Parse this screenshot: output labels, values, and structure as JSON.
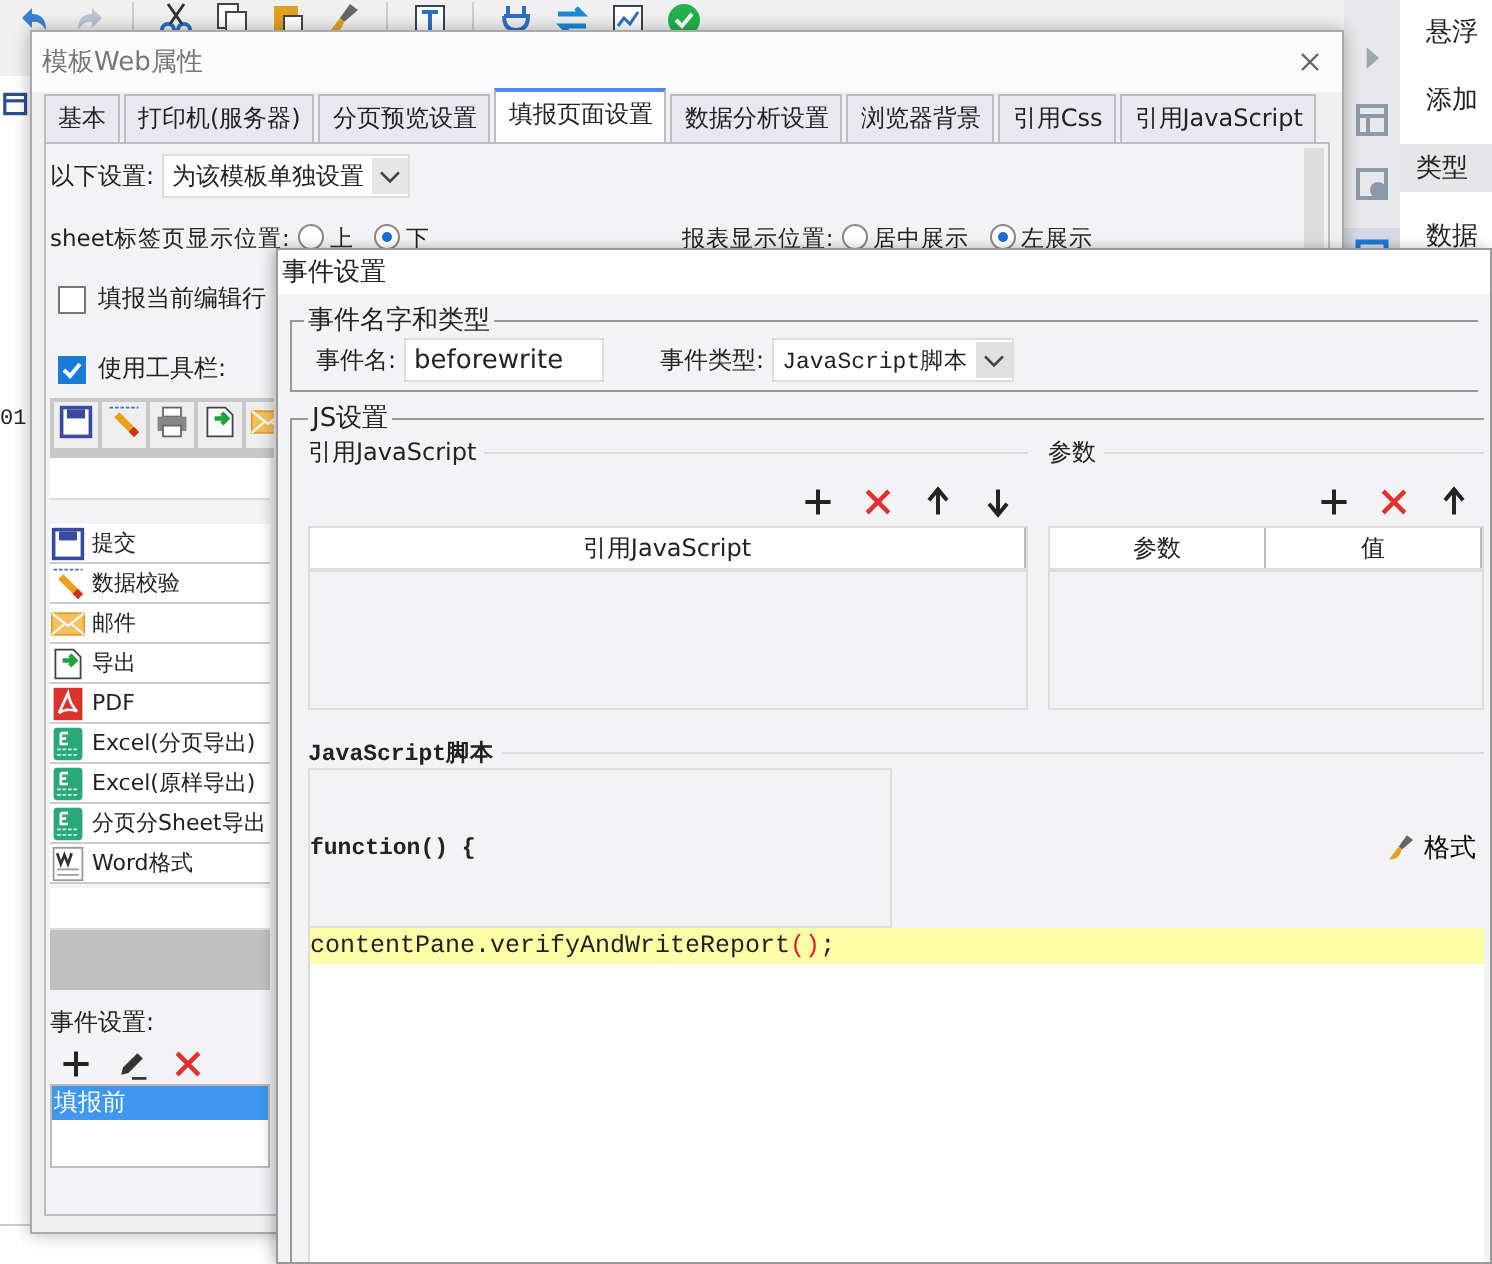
{
  "app": {
    "cell_text": "01",
    "side_panel": [
      {
        "label": "悬浮",
        "kind": "plain"
      },
      {
        "label": "添加",
        "kind": "plain"
      },
      {
        "label": "类型",
        "kind": "header"
      },
      {
        "label": "数据",
        "kind": "plain"
      }
    ]
  },
  "web_properties": {
    "title": "模板Web属性",
    "tabs": [
      {
        "label": "基本",
        "selected": false
      },
      {
        "label": "打印机(服务器)",
        "selected": false
      },
      {
        "label": "分页预览设置",
        "selected": false
      },
      {
        "label": "填报页面设置",
        "selected": true
      },
      {
        "label": "数据分析设置",
        "selected": false
      },
      {
        "label": "浏览器背景",
        "selected": false
      },
      {
        "label": "引用Css",
        "selected": false
      },
      {
        "label": "引用JavaScript",
        "selected": false
      }
    ],
    "settings": {
      "label": "以下设置:",
      "value": "为该模板单独设置"
    },
    "sheet_position": {
      "label": "sheet标签页显示位置:",
      "options": [
        {
          "label": "上",
          "selected": false
        },
        {
          "label": "下",
          "selected": true
        }
      ]
    },
    "report_position": {
      "label": "报表显示位置:",
      "options": [
        {
          "label": "居中展示",
          "selected": false
        },
        {
          "label": "左展示",
          "selected": true
        }
      ]
    },
    "highlight_row": {
      "label": "填报当前编辑行",
      "checked": false
    },
    "use_toolbar": {
      "label": "使用工具栏:",
      "checked": true
    },
    "buttons": [
      {
        "label": "提交",
        "kind": "save"
      },
      {
        "label": "数据校验",
        "kind": "verify"
      },
      {
        "label": "邮件",
        "kind": "mail"
      },
      {
        "label": "导出",
        "kind": "export"
      },
      {
        "label": "PDF",
        "kind": "pdf"
      },
      {
        "label": "Excel(分页导出)",
        "kind": "excel"
      },
      {
        "label": "Excel(原样导出)",
        "kind": "excel"
      },
      {
        "label": "分页分Sheet导出",
        "kind": "excel"
      },
      {
        "label": "Word格式",
        "kind": "word"
      }
    ],
    "event_label": "事件设置:",
    "events": [
      {
        "label": "填报前",
        "selected": true
      }
    ]
  },
  "event_dialog": {
    "title": "事件设置",
    "name_group": "事件名字和类型",
    "name_label": "事件名:",
    "name_value": "beforewrite",
    "type_label": "事件类型:",
    "type_value": "JavaScript脚本",
    "js_group": "JS设置",
    "references": {
      "title": "引用JavaScript",
      "columns": [
        "引用JavaScript"
      ]
    },
    "parameters": {
      "title": "参数",
      "columns": [
        "参数",
        "值"
      ]
    },
    "script": {
      "title": "JavaScript脚本",
      "header": "function() {",
      "format_button": "格式",
      "code": [
        {
          "text": "contentPane.verifyAndWriteReport",
          "kind": "plain"
        },
        {
          "text": "()",
          "kind": "paren"
        },
        {
          "text": ";",
          "kind": "plain"
        }
      ]
    }
  }
}
